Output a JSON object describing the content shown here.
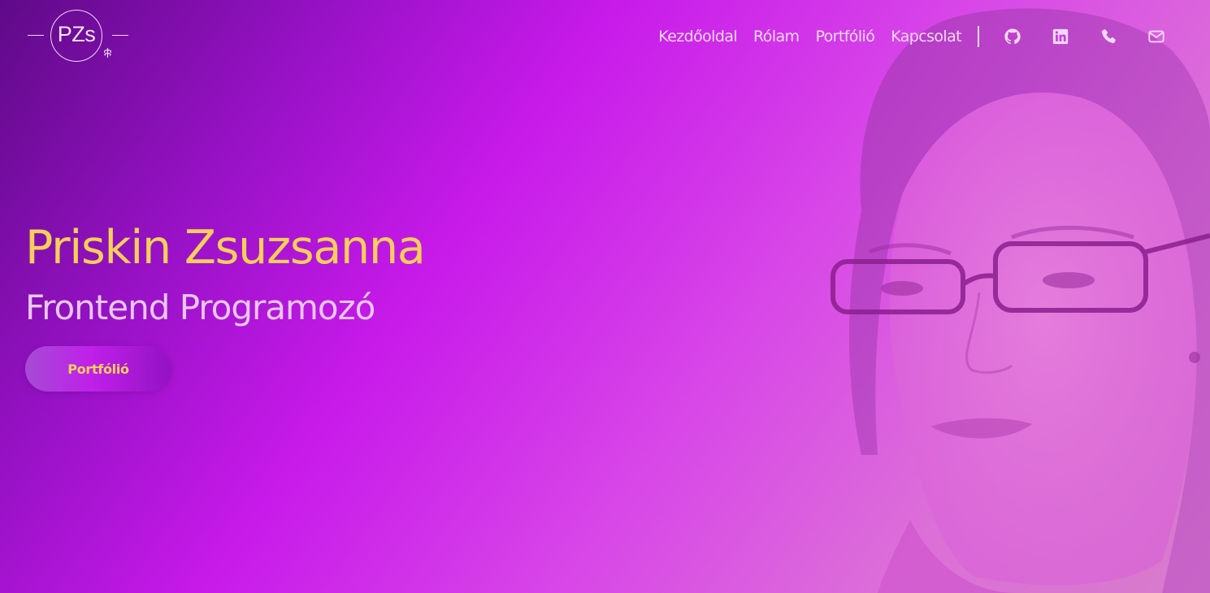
{
  "brand": {
    "monogram": "PZs",
    "leaf_icon": "leaf-icon"
  },
  "nav": {
    "links": [
      {
        "label": "Kezdőoldal"
      },
      {
        "label": "Rólam"
      },
      {
        "label": "Portfólió"
      },
      {
        "label": "Kapcsolat"
      }
    ],
    "icons": [
      "github-icon",
      "linkedin-icon",
      "phone-icon",
      "envelope-icon"
    ]
  },
  "hero": {
    "name": "Priskin Zsuzsanna",
    "role": "Frontend Programozó",
    "cta_label": "Portfólió"
  },
  "colors": {
    "accent_yellow": "#f4cf5a",
    "gradient_dark": "#5f0a88",
    "gradient_magenta": "#c81aea",
    "gradient_pink": "#d77ccb",
    "nav_text": "#f1d9f8"
  }
}
